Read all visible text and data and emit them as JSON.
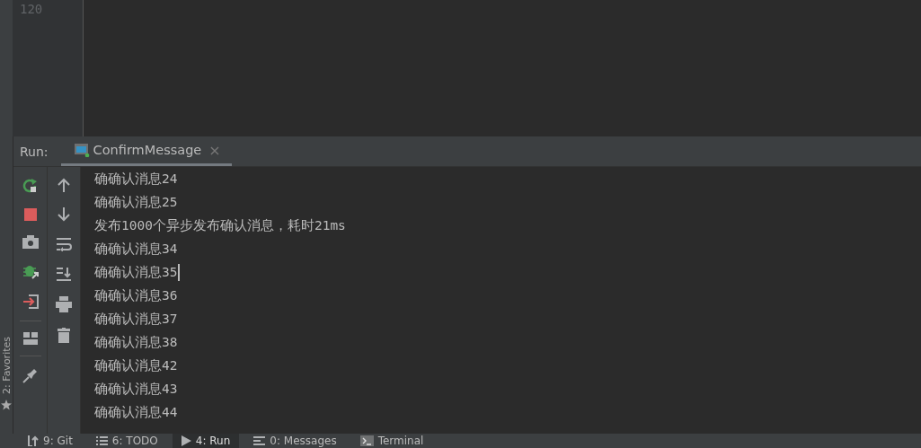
{
  "editor": {
    "line_number": "120"
  },
  "favorites_label": "2: Favorites",
  "run_panel": {
    "label": "Run:",
    "tabs": [
      {
        "label": "ConfirmMessage",
        "selected": true,
        "close": "×"
      }
    ]
  },
  "console": {
    "lines": [
      {
        "text": "确确认消息24",
        "caret": false
      },
      {
        "text": "确确认消息25",
        "caret": false
      },
      {
        "text": "发布1000个异步发布确认消息，耗时21ms",
        "caret": false
      },
      {
        "text": "确确认消息34",
        "caret": false
      },
      {
        "text": "确确认消息35",
        "caret": true
      },
      {
        "text": "确确认消息36",
        "caret": false
      },
      {
        "text": "确确认消息37",
        "caret": false
      },
      {
        "text": "确确认消息38",
        "caret": false
      },
      {
        "text": "确确认消息42",
        "caret": false
      },
      {
        "text": "确确认消息43",
        "caret": false
      },
      {
        "text": "确确认消息44",
        "caret": false
      }
    ]
  },
  "tool_windows": [
    {
      "kind": "git",
      "label": "9: Git",
      "selected": false
    },
    {
      "kind": "todo",
      "label": "6: TODO",
      "selected": false
    },
    {
      "kind": "run",
      "label": "4: Run",
      "selected": true
    },
    {
      "kind": "messages",
      "label": "0: Messages",
      "selected": false
    },
    {
      "kind": "terminal",
      "label": "Terminal",
      "selected": false
    }
  ]
}
